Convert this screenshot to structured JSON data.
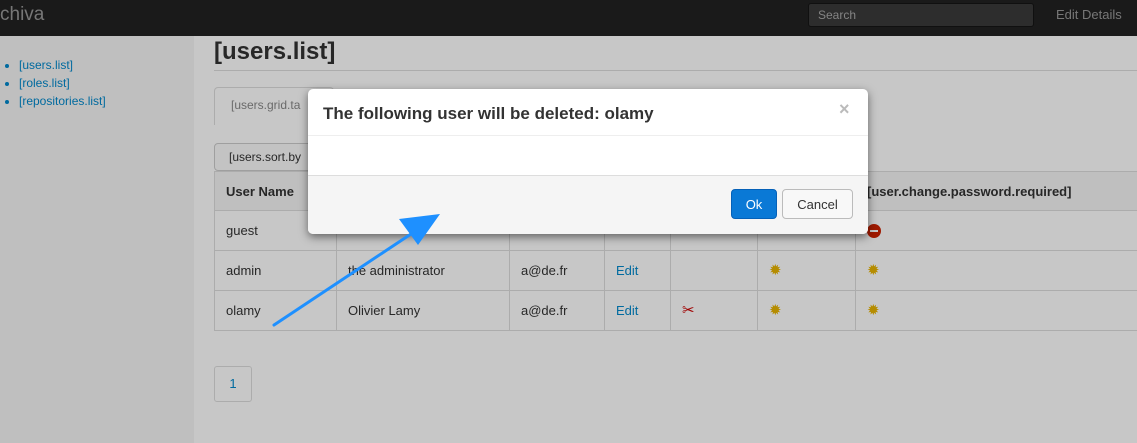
{
  "topbar": {
    "brand": "chiva",
    "search_placeholder": "Search",
    "edit_details": "Edit Details"
  },
  "sidebar": {
    "items": [
      {
        "label": "[users.list]"
      },
      {
        "label": "[roles.list]"
      },
      {
        "label": "[repositories.list]"
      }
    ]
  },
  "main": {
    "title": "[users.list]",
    "tab_label": "[users.grid.ta",
    "sort_button": "[users.sort.by",
    "table": {
      "header_user_name": "User Name",
      "header_password_required": "[user.change.password.required]",
      "rows": [
        {
          "username": "guest",
          "fullname": "",
          "email": "",
          "edit": ""
        },
        {
          "username": "admin",
          "fullname": "the administrator",
          "email": "a@de.fr",
          "edit": "Edit"
        },
        {
          "username": "olamy",
          "fullname": "Olivier Lamy",
          "email": "a@de.fr",
          "edit": "Edit"
        }
      ]
    },
    "pagination": {
      "current": "1"
    }
  },
  "modal": {
    "title": "The following user will be deleted: olamy",
    "close": "×",
    "ok_label": "Ok",
    "cancel_label": "Cancel"
  },
  "annotation": {
    "arrow_color": "#1e90ff"
  },
  "colors": {
    "accent": "#0a79d6",
    "link": "#0088cc",
    "topbar": "#222222"
  }
}
